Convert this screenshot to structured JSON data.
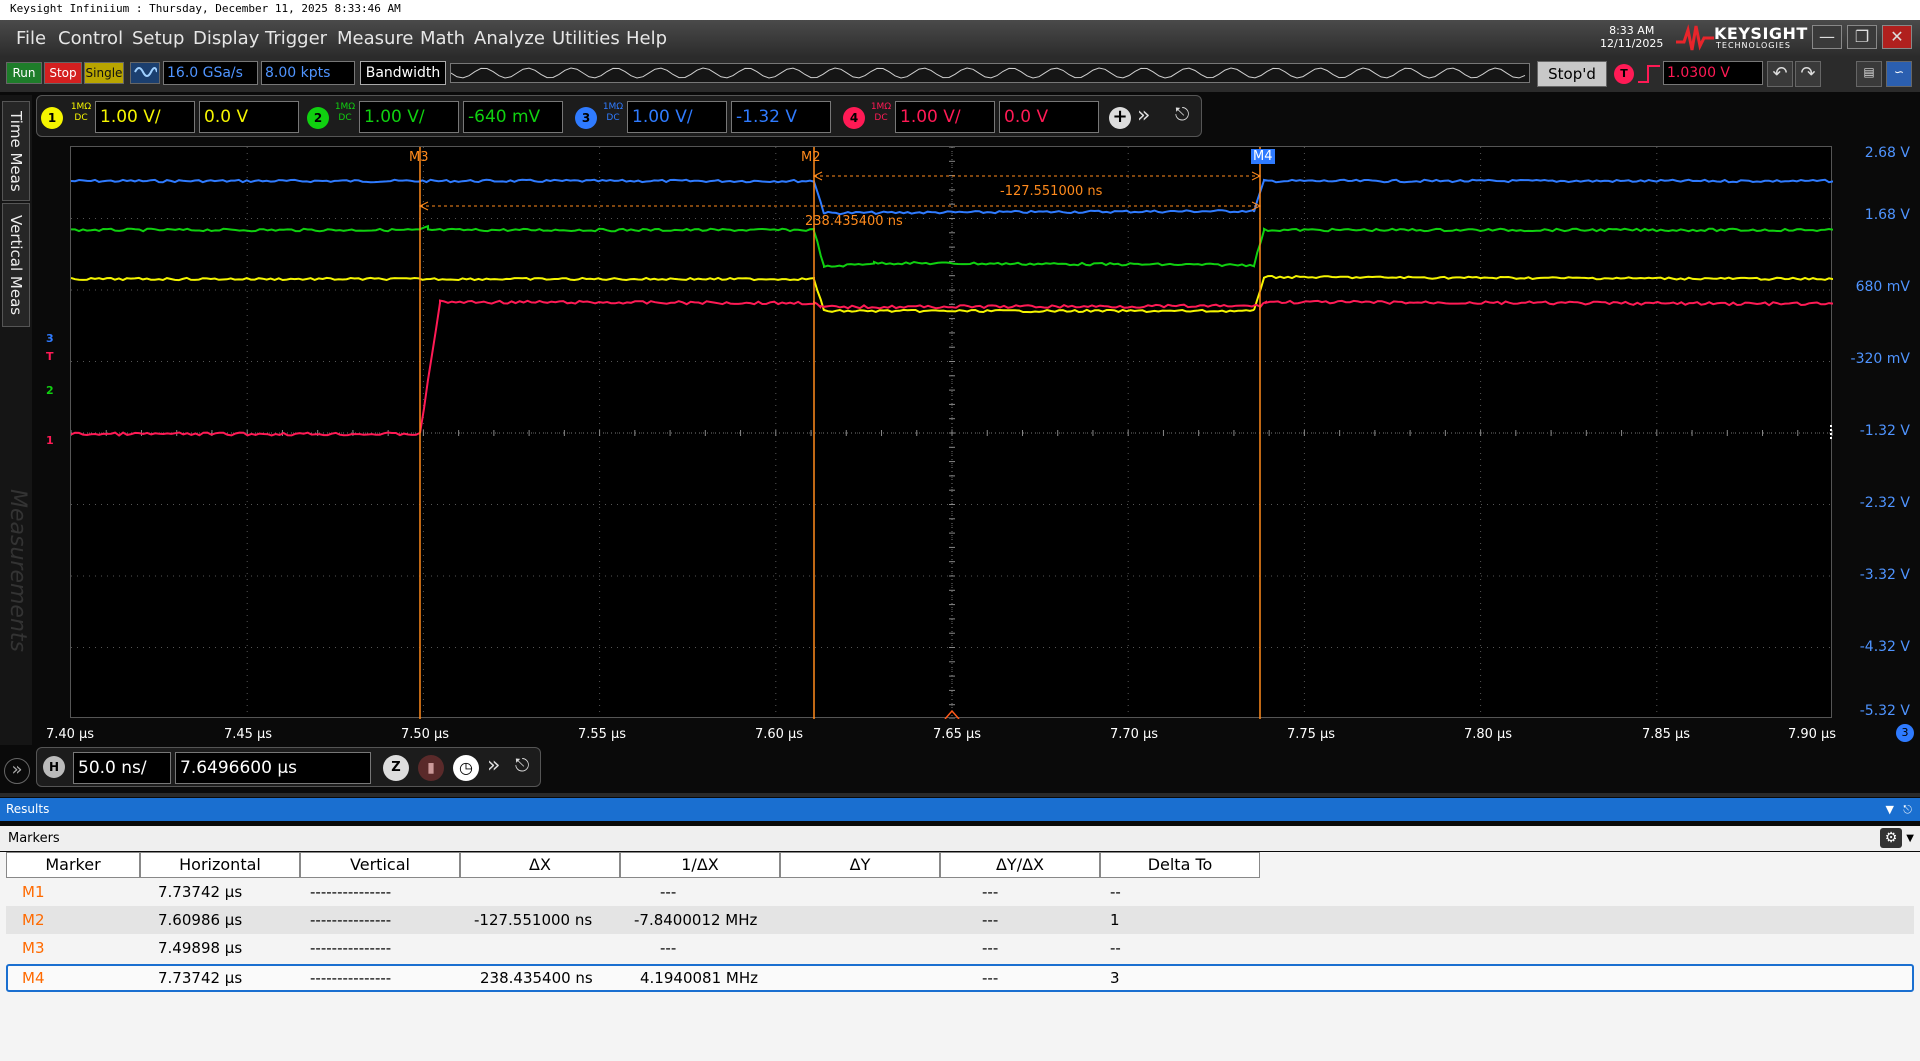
{
  "window": {
    "title": "Keysight Infiniium : Thursday, December 11, 2025 8:33:46 AM",
    "clock_time": "8:33 AM",
    "clock_date": "12/11/2025",
    "brand": "KEYSIGHT",
    "brand_sub": "TECHNOLOGIES"
  },
  "menu": [
    "File",
    "Control",
    "Setup",
    "Display",
    "Trigger",
    "Measure",
    "Math",
    "Analyze",
    "Utilities",
    "Help"
  ],
  "toolbar": {
    "run": "Run",
    "stop": "Stop",
    "single": "Single",
    "sample_rate": "16.0 GSa/s",
    "memory_depth": "8.00 kpts",
    "bandwidth": "Bandwidth",
    "status": "Stop'd",
    "trigger_level": "1.0300 V",
    "trigger_badge": "T"
  },
  "channels": [
    {
      "num": "1",
      "coupling_top": "1MΩ",
      "coupling_bottom": "DC",
      "scale": "1.00 V/",
      "offset": "0.0 V",
      "color": "#f5f500"
    },
    {
      "num": "2",
      "coupling_top": "1MΩ",
      "coupling_bottom": "DC",
      "scale": "1.00 V/",
      "offset": "-640 mV",
      "color": "#10d010"
    },
    {
      "num": "3",
      "coupling_top": "1MΩ",
      "coupling_bottom": "DC",
      "scale": "1.00 V/",
      "offset": "-1.32 V",
      "color": "#2f7bff"
    },
    {
      "num": "4",
      "coupling_top": "1MΩ",
      "coupling_bottom": "DC",
      "scale": "1.00 V/",
      "offset": "0.0 V",
      "color": "#ff1a55"
    }
  ],
  "left_tabs": [
    "Time Meas",
    "Vertical Meas",
    "Measurements"
  ],
  "plot": {
    "y_labels": [
      "2.68 V",
      "1.68 V",
      "680 mV",
      "-320 mV",
      "-1.32 V",
      "-2.32 V",
      "-3.32 V",
      "-4.32 V",
      "-5.32 V"
    ],
    "x_labels": [
      "7.40 µs",
      "7.45 µs",
      "7.50 µs",
      "7.55 µs",
      "7.60 µs",
      "7.65 µs",
      "7.70 µs",
      "7.75 µs",
      "7.80 µs",
      "7.85 µs",
      "7.90 µs"
    ],
    "marker_labels": [
      "M3",
      "M2",
      "M4"
    ],
    "delta_m2": "-127.551000 ns",
    "delta_m4": "238.435400 ns",
    "x_badge": "3",
    "ground_markers": [
      "T",
      "3",
      "2",
      "1"
    ],
    "colors": {
      "marker": "#ff8a1c",
      "grid": "#555555",
      "axis_label": "#4f94ff"
    }
  },
  "timebase": {
    "badge": "H",
    "scale": "50.0 ns/",
    "position": "7.6496600 µs",
    "zoom_badge": "Z"
  },
  "results": {
    "title": "Results",
    "section": "Markers",
    "columns": [
      "Marker",
      "Horizontal",
      "Vertical",
      "ΔX",
      "1/ΔX",
      "ΔY",
      "ΔY/ΔX",
      "Delta To"
    ],
    "rows": [
      {
        "marker": "M1",
        "horizontal": "7.73742 µs",
        "vertical": "---------------",
        "dx": "",
        "inv_dx": "---",
        "dy": "",
        "dydx": "---",
        "delta_to": "--"
      },
      {
        "marker": "M2",
        "horizontal": "7.60986 µs",
        "vertical": "---------------",
        "dx": "-127.551000 ns",
        "inv_dx": "-7.8400012 MHz",
        "dy": "",
        "dydx": "---",
        "delta_to": "1"
      },
      {
        "marker": "M3",
        "horizontal": "7.49898 µs",
        "vertical": "---------------",
        "dx": "",
        "inv_dx": "---",
        "dy": "",
        "dydx": "---",
        "delta_to": "--"
      },
      {
        "marker": "M4",
        "horizontal": "7.73742 µs",
        "vertical": "---------------",
        "dx": "238.435400 ns",
        "inv_dx": "4.1940081 MHz",
        "dy": "",
        "dydx": "---",
        "delta_to": "3"
      }
    ]
  }
}
